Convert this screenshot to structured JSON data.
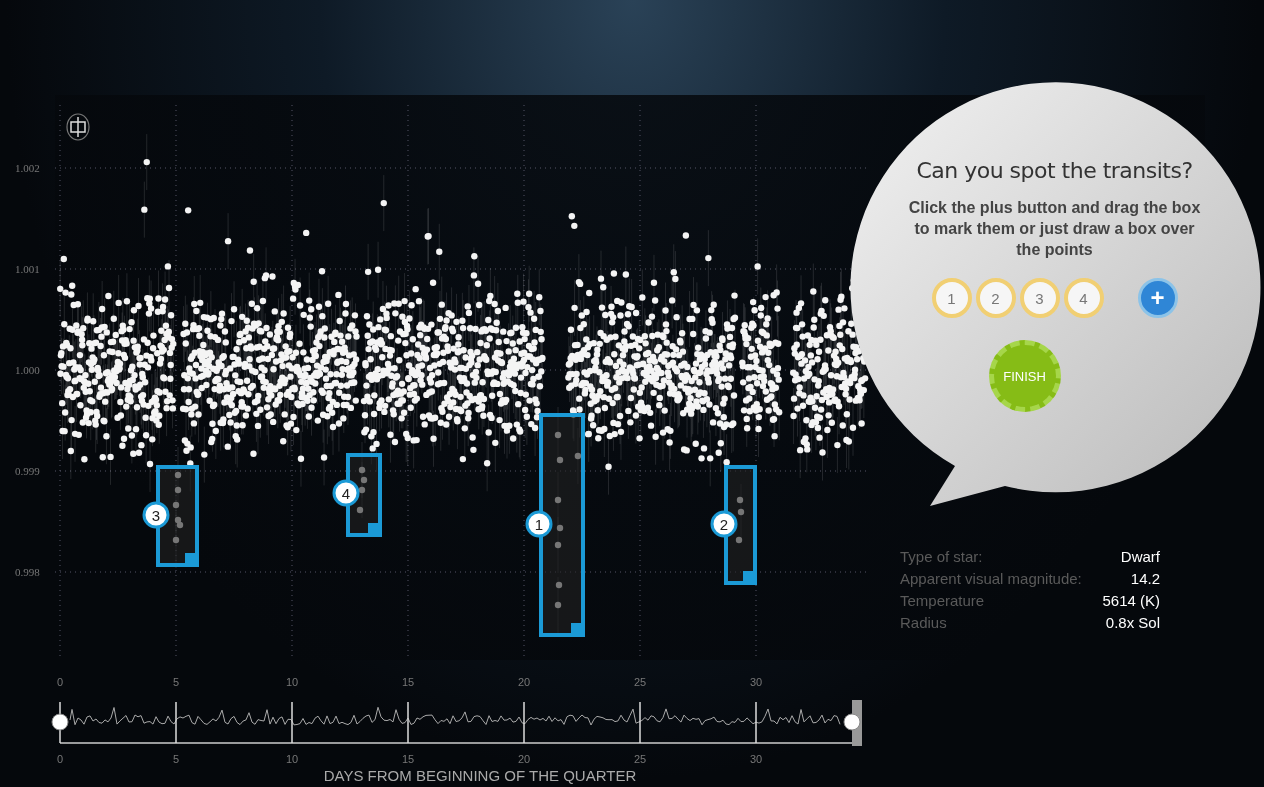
{
  "chart": {
    "y_labels": [
      "1.002",
      "1.001",
      "1.000",
      "0.999",
      "0.998"
    ]
  },
  "transit_markers": [
    {
      "label": "3"
    },
    {
      "label": "4"
    },
    {
      "label": "1"
    },
    {
      "label": "2"
    }
  ],
  "prompt": {
    "title": "Can you spot the transits?",
    "instructions": "Click the plus button and drag the box to mark them or just draw a box over the points",
    "slots": [
      {
        "label": "1"
      },
      {
        "label": "2"
      },
      {
        "label": "3"
      },
      {
        "label": "4"
      }
    ],
    "add_button": "+",
    "finish_button": "FINISH"
  },
  "star_info": [
    {
      "label": "Type of star:",
      "value": "Dwarf"
    },
    {
      "label": "Apparent visual magnitude:",
      "value": "14.2"
    },
    {
      "label": "Temperature",
      "value": "5614 (K)"
    },
    {
      "label": "Radius",
      "value": "0.8x Sol"
    }
  ],
  "timeline": {
    "top_labels": [
      "0",
      "5",
      "10",
      "15",
      "20",
      "25",
      "30"
    ],
    "bottom_labels": [
      "0",
      "5",
      "10",
      "15",
      "20",
      "25",
      "30"
    ],
    "axis_title": "DAYS FROM BEGINNING OF THE QUARTER"
  }
}
